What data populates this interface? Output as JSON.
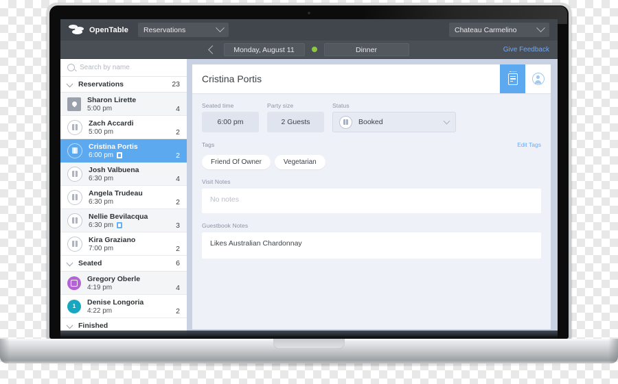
{
  "app": {
    "brand": "OpenTable",
    "view_selector": "Reservations",
    "venue_selector": "Chateau Carmelino",
    "date": "Monday, August 11",
    "shift": "Dinner",
    "feedback_link": "Give Feedback",
    "status_dot_color": "#8ec63f",
    "accent_color": "#5ca9ef",
    "chrome_color": "#41454c"
  },
  "sidebar": {
    "search_placeholder": "Search by name",
    "groups": [
      {
        "title": "Reservations",
        "count": "23",
        "rows": [
          {
            "name": "Sharon Lirette",
            "time": "5:00 pm",
            "party": "4",
            "avatar": "pin-square",
            "note_badge": false,
            "selected": false
          },
          {
            "name": "Zach Accardi",
            "time": "5:00 pm",
            "party": "2",
            "avatar": "book-circle",
            "note_badge": false,
            "selected": false
          },
          {
            "name": "Cristina Portis",
            "time": "6:00 pm",
            "party": "2",
            "avatar": "book-circle",
            "note_badge": true,
            "selected": true
          },
          {
            "name": "Josh Valbuena",
            "time": "6:30 pm",
            "party": "4",
            "avatar": "book-circle",
            "note_badge": false,
            "selected": false
          },
          {
            "name": "Angela Trudeau",
            "time": "6:30 pm",
            "party": "2",
            "avatar": "book-circle",
            "note_badge": false,
            "selected": false
          },
          {
            "name": "Nellie Bevilacqua",
            "time": "6:30 pm",
            "party": "3",
            "avatar": "book-circle",
            "note_badge": true,
            "selected": false
          },
          {
            "name": "Kira Graziano",
            "time": "7:00 pm",
            "party": "2",
            "avatar": "book-circle",
            "note_badge": false,
            "selected": false
          }
        ]
      },
      {
        "title": "Seated",
        "count": "6",
        "rows": [
          {
            "name": "Gregory Oberle",
            "time": "4:19 pm",
            "party": "4",
            "avatar": "solid-purple",
            "avatar_color": "#b562d6",
            "note_badge": false,
            "selected": false
          },
          {
            "name": "Denise Longoria",
            "time": "4:22 pm",
            "party": "2",
            "avatar": "solid-teal",
            "avatar_color": "#17a7c0",
            "initial": "1",
            "note_badge": false,
            "selected": false
          }
        ]
      },
      {
        "title": "Finished",
        "count": "",
        "rows": []
      }
    ]
  },
  "detail": {
    "guest_name": "Cristina Portis",
    "tab_notes_icon": "notepad-icon",
    "tab_profile_icon": "person-icon",
    "fields": {
      "seated_time_label": "Seated time",
      "seated_time_value": "6:00 pm",
      "party_size_label": "Party size",
      "party_size_value": "2 Guests",
      "status_label": "Status",
      "status_value": "Booked"
    },
    "tags_label": "Tags",
    "edit_tags_link": "Edit Tags",
    "tags": [
      "Friend Of Owner",
      "Vegetarian"
    ],
    "visit_notes_label": "Visit Notes",
    "visit_notes_placeholder": "No notes",
    "guestbook_notes_label": "Guestbook Notes",
    "guestbook_notes_value": "Likes Australian Chardonnay"
  }
}
